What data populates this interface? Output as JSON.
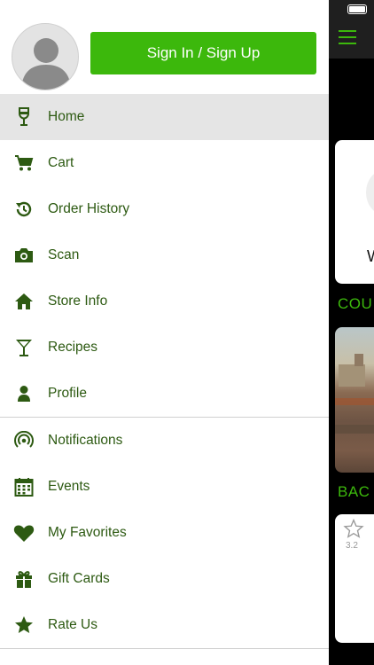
{
  "header": {
    "signin_label": "Sign In / Sign Up"
  },
  "menu": {
    "primary": [
      {
        "label": "Home",
        "icon": "wine-glass-icon",
        "active": true
      },
      {
        "label": "Cart",
        "icon": "cart-icon"
      },
      {
        "label": "Order History",
        "icon": "history-icon"
      },
      {
        "label": "Scan",
        "icon": "camera-icon"
      },
      {
        "label": "Store Info",
        "icon": "home-icon"
      },
      {
        "label": "Recipes",
        "icon": "cocktail-icon"
      },
      {
        "label": "Profile",
        "icon": "person-icon"
      }
    ],
    "secondary": [
      {
        "label": "Notifications",
        "icon": "broadcast-icon"
      },
      {
        "label": "Events",
        "icon": "calendar-icon"
      },
      {
        "label": "My Favorites",
        "icon": "heart-icon"
      },
      {
        "label": "Gift Cards",
        "icon": "gift-icon"
      },
      {
        "label": "Rate Us",
        "icon": "star-icon"
      }
    ]
  },
  "background": {
    "card1_text": "W",
    "section1_title": "COU",
    "section2_title": "BAC",
    "rating": "3.2"
  },
  "colors": {
    "accent": "#3cb80c",
    "menu_text": "#2d5a12",
    "icon": "#2d5a12",
    "active_bg": "#e5e5e5"
  }
}
